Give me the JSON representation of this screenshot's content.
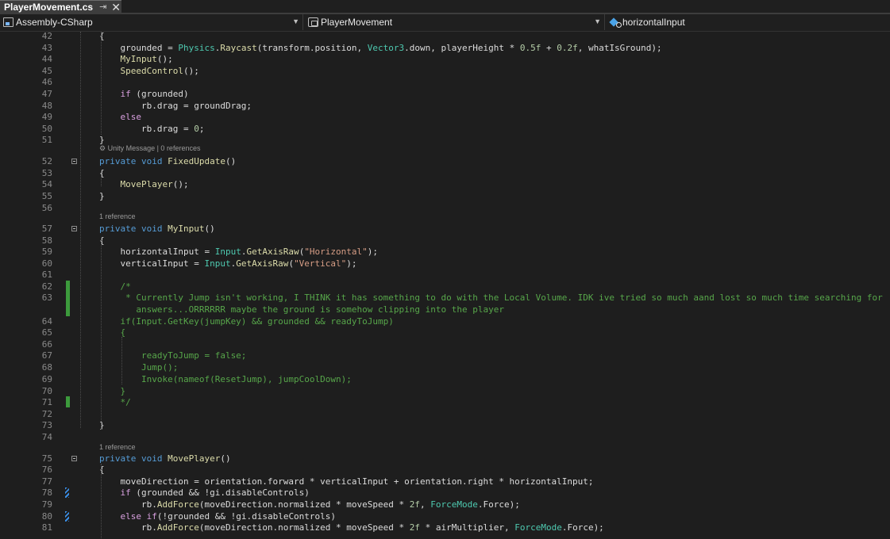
{
  "tab": {
    "title": "PlayerMovement.cs",
    "pin_glyph": "⇥",
    "close_glyph": "✕"
  },
  "nav": {
    "project": "Assembly-CSharp",
    "type": "PlayerMovement",
    "member": "horizontalInput",
    "icons": [
      "project-icon",
      "class-icon",
      "field-icon"
    ]
  },
  "editor": {
    "lens_unity": "Unity Message | 0 references",
    "lens_ref": "1 reference",
    "lines": [
      {
        "n": "42",
        "t": "        {"
      },
      {
        "n": "43",
        "t": "            grounded = Physics.Raycast(transform.position, Vector3.down, playerHeight * 0.5f + 0.2f, whatIsGround);"
      },
      {
        "n": "44",
        "t": "            MyInput();"
      },
      {
        "n": "45",
        "t": "            SpeedControl();"
      },
      {
        "n": "46",
        "t": ""
      },
      {
        "n": "47",
        "t": "            if (grounded)"
      },
      {
        "n": "48",
        "t": "                rb.drag = groundDrag;"
      },
      {
        "n": "49",
        "t": "            else"
      },
      {
        "n": "50",
        "t": "                rb.drag = 0;"
      },
      {
        "n": "51",
        "t": "        }"
      },
      {
        "n": "52",
        "t": "        private void FixedUpdate()"
      },
      {
        "n": "53",
        "t": "        {"
      },
      {
        "n": "54",
        "t": "            MovePlayer();"
      },
      {
        "n": "55",
        "t": "        }"
      },
      {
        "n": "56",
        "t": ""
      },
      {
        "n": "57",
        "t": "        private void MyInput()"
      },
      {
        "n": "58",
        "t": "        {"
      },
      {
        "n": "59",
        "t": "            horizontalInput = Input.GetAxisRaw(\"Horizontal\");"
      },
      {
        "n": "60",
        "t": "            verticalInput = Input.GetAxisRaw(\"Vertical\");"
      },
      {
        "n": "61",
        "t": ""
      },
      {
        "n": "62",
        "t": "            /*"
      },
      {
        "n": "63",
        "t": "             * Currently Jump isn't working, I THINK it has something to do with the Local Volume. IDK ive tried so much aand lost so much time searching for"
      },
      {
        "n": "",
        "t": "               answers...ORRRRRR maybe the ground is somehow clipping into the player"
      },
      {
        "n": "64",
        "t": "            if(Input.GetKey(jumpKey) && grounded && readyToJump)"
      },
      {
        "n": "65",
        "t": "            {"
      },
      {
        "n": "66",
        "t": ""
      },
      {
        "n": "67",
        "t": "                readyToJump = false;"
      },
      {
        "n": "68",
        "t": "                Jump();"
      },
      {
        "n": "69",
        "t": "                Invoke(nameof(ResetJump), jumpCoolDown);"
      },
      {
        "n": "70",
        "t": "            }"
      },
      {
        "n": "71",
        "t": "            */"
      },
      {
        "n": "72",
        "t": ""
      },
      {
        "n": "73",
        "t": "        }"
      },
      {
        "n": "74",
        "t": ""
      },
      {
        "n": "75",
        "t": "        private void MovePlayer()"
      },
      {
        "n": "76",
        "t": "        {"
      },
      {
        "n": "77",
        "t": "            moveDirection = orientation.forward * verticalInput + orientation.right * horizontalInput;"
      },
      {
        "n": "78",
        "t": "            if (grounded && !gi.disableControls)"
      },
      {
        "n": "79",
        "t": "                rb.AddForce(moveDirection.normalized * moveSpeed * 2f, ForceMode.Force);"
      },
      {
        "n": "80",
        "t": "            else if(!grounded && !gi.disableControls)"
      },
      {
        "n": "81",
        "t": "                rb.AddForce(moveDirection.normalized * moveSpeed * 2f * airMultiplier, ForceMode.Force);"
      }
    ]
  }
}
